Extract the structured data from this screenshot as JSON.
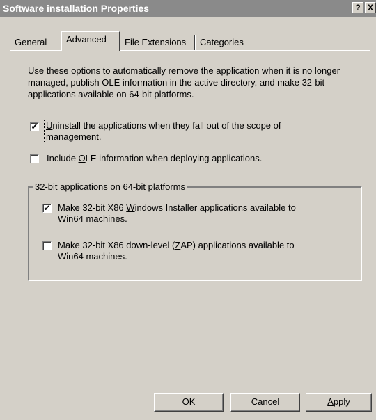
{
  "window": {
    "title": "Software installation Properties",
    "help_label": "?",
    "close_label": "X"
  },
  "tabs": [
    {
      "label": "General",
      "active": false
    },
    {
      "label": "Advanced",
      "active": true
    },
    {
      "label": "File Extensions",
      "active": false
    },
    {
      "label": "Categories",
      "active": false
    }
  ],
  "description": "Use these options to automatically remove the application when it is no longer managed, publish OLE information in the active directory, and make 32-bit applications available on 64-bit platforms.",
  "options": {
    "uninstall": {
      "checked": true,
      "mnemonic": "U",
      "label_rest_line1": "ninstall the applications when they fall out of the scope of",
      "label_line2": "management."
    },
    "ole": {
      "checked": false,
      "prefix": "Include ",
      "mnemonic": "O",
      "suffix": "LE information when deploying applications."
    }
  },
  "group": {
    "legend": "32-bit applications on 64-bit platforms",
    "windows_installer": {
      "checked": true,
      "prefix": "Make 32-bit X86 ",
      "mnemonic": "W",
      "suffix": "indows Installer applications available to",
      "line2": "Win64 machines."
    },
    "zap": {
      "checked": false,
      "prefix": "Make 32-bit X86 down-level (",
      "mnemonic": "Z",
      "suffix": "AP) applications available to",
      "line2": "Win64 machines."
    }
  },
  "buttons": {
    "ok": "OK",
    "cancel": "Cancel",
    "apply_mnemonic": "A",
    "apply_rest": "pply"
  },
  "check_glyph": "✔"
}
